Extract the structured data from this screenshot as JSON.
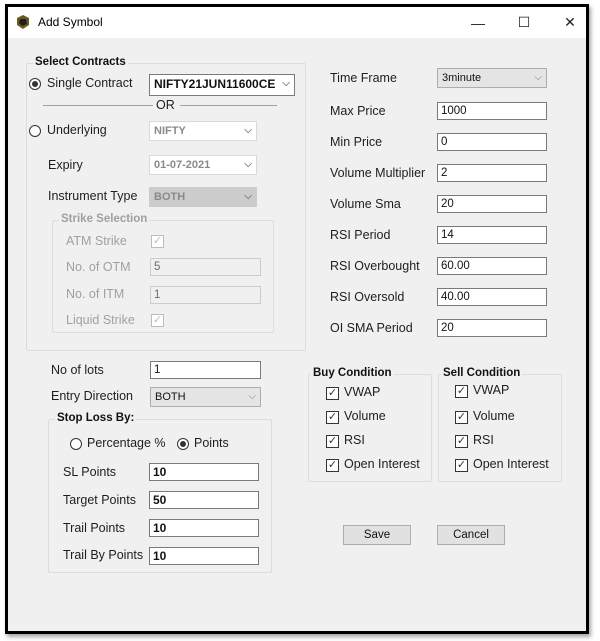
{
  "window": {
    "title": "Add Symbol",
    "controls": {
      "minimize": "—",
      "maximize": "☐",
      "close": "✕"
    }
  },
  "select_contracts": {
    "title": "Select Contracts",
    "single_contract_label": "Single Contract",
    "single_contract_selected": true,
    "single_contract_value": "NIFTY21JUN11600CE",
    "or_label": "OR",
    "underlying_label": "Underlying",
    "underlying_selected": false,
    "underlying_value": "NIFTY",
    "expiry_label": "Expiry",
    "expiry_value": "01-07-2021",
    "instrument_type_label": "Instrument Type",
    "instrument_type_value": "BOTH",
    "strike_selection": {
      "title": "Strike Selection",
      "atm_strike_label": "ATM Strike",
      "atm_strike_checked": true,
      "otm_label": "No. of OTM",
      "otm_value": "5",
      "itm_label": "No. of ITM",
      "itm_value": "1",
      "liquid_strike_label": "Liquid Strike",
      "liquid_strike_checked": true
    }
  },
  "parameters": {
    "time_frame_label": "Time Frame",
    "time_frame_value": "3minute",
    "max_price_label": "Max Price",
    "max_price_value": "1000",
    "min_price_label": "Min Price",
    "min_price_value": "0",
    "volume_multiplier_label": "Volume Multiplier",
    "volume_multiplier_value": "2",
    "volume_sma_label": "Volume Sma",
    "volume_sma_value": "20",
    "rsi_period_label": "RSI Period",
    "rsi_period_value": "14",
    "rsi_overbought_label": "RSI Overbought",
    "rsi_overbought_value": "60.00",
    "rsi_oversold_label": "RSI Oversold",
    "rsi_oversold_value": "40.00",
    "oi_sma_label": "OI SMA Period",
    "oi_sma_value": "20"
  },
  "order": {
    "lots_label": "No of lots",
    "lots_value": "1",
    "entry_direction_label": "Entry Direction",
    "entry_direction_value": "BOTH"
  },
  "stop_loss": {
    "title": "Stop Loss By:",
    "percentage_label": "Percentage %",
    "percentage_selected": false,
    "points_label": "Points",
    "points_selected": true,
    "sl_points_label": "SL Points",
    "sl_points_value": "10",
    "target_points_label": "Target Points",
    "target_points_value": "50",
    "trail_points_label": "Trail Points",
    "trail_points_value": "10",
    "trail_by_points_label": "Trail By Points",
    "trail_by_points_value": "10"
  },
  "buy_condition": {
    "title": "Buy Condition",
    "items": [
      {
        "label": "VWAP",
        "checked": true
      },
      {
        "label": "Volume",
        "checked": true
      },
      {
        "label": "RSI",
        "checked": true
      },
      {
        "label": "Open Interest",
        "checked": true
      }
    ]
  },
  "sell_condition": {
    "title": "Sell Condition",
    "items": [
      {
        "label": "VWAP",
        "checked": true
      },
      {
        "label": "Volume",
        "checked": true
      },
      {
        "label": "RSI",
        "checked": true
      },
      {
        "label": "Open Interest",
        "checked": true
      }
    ]
  },
  "buttons": {
    "save": "Save",
    "cancel": "Cancel"
  },
  "icons": {
    "check": "✓",
    "chevron": "⌵"
  }
}
